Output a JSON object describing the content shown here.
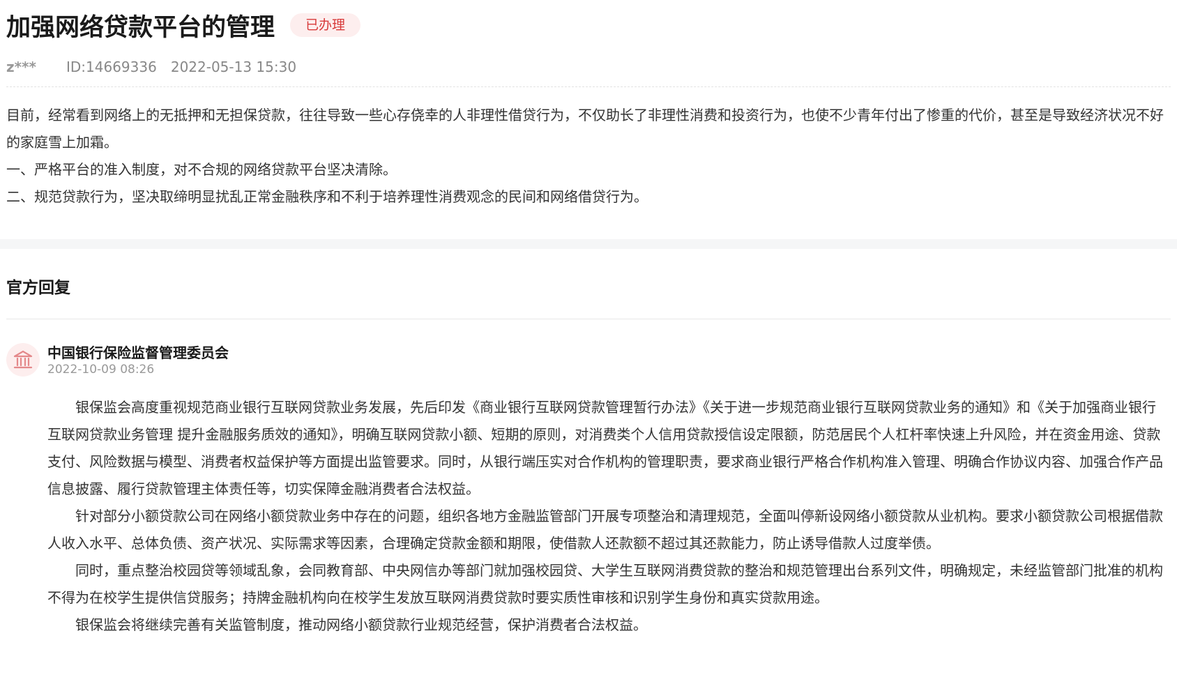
{
  "header": {
    "title": "加强网络贷款平台的管理",
    "status": "已办理",
    "user": "z***",
    "id_label": "ID:14669336",
    "datetime": "2022-05-13 15:30"
  },
  "question": {
    "paragraphs": [
      "目前，经常看到网络上的无抵押和无担保贷款，往往导致一些心存侥幸的人非理性借贷行为，不仅助长了非理性消费和投资行为，也使不少青年付出了惨重的代价，甚至是导致经济状况不好的家庭雪上加霜。",
      "一、严格平台的准入制度，对不合规的网络贷款平台坚决清除。",
      "二、规范贷款行为，坚决取缔明显扰乱正常金融秩序和不利于培养理性消费观念的民间和网络借贷行为。"
    ]
  },
  "reply": {
    "heading": "官方回复",
    "org_icon": "bank-building-icon",
    "org_name": "中国银行保险监督管理委员会",
    "datetime": "2022-10-09 08:26",
    "paragraphs": [
      "银保监会高度重视规范商业银行互联网贷款业务发展，先后印发《商业银行互联网贷款管理暂行办法》《关于进一步规范商业银行互联网贷款业务的通知》和《关于加强商业银行互联网贷款业务管理 提升金融服务质效的通知》，明确互联网贷款小额、短期的原则，对消费类个人信用贷款授信设定限额，防范居民个人杠杆率快速上升风险，并在资金用途、贷款支付、风险数据与模型、消费者权益保护等方面提出监管要求。同时，从银行端压实对合作机构的管理职责，要求商业银行严格合作机构准入管理、明确合作协议内容、加强合作产品信息披露、履行贷款管理主体责任等，切实保障金融消费者合法权益。",
      "针对部分小额贷款公司在网络小额贷款业务中存在的问题，组织各地方金融监管部门开展专项整治和清理规范，全面叫停新设网络小额贷款从业机构。要求小额贷款公司根据借款人收入水平、总体负债、资产状况、实际需求等因素，合理确定贷款金额和期限，使借款人还款额不超过其还款能力，防止诱导借款人过度举债。",
      "同时，重点整治校园贷等领域乱象，会同教育部、中央网信办等部门就加强校园贷、大学生互联网消费贷款的整治和规范管理出台系列文件，明确规定，未经监管部门批准的机构不得为在校学生提供信贷服务；持牌金融机构向在校学生发放互联网消费贷款时要实质性审核和识别学生身份和真实贷款用途。",
      "银保监会将继续完善有关监管制度，推动网络小额贷款行业规范经营，保护消费者合法权益。"
    ]
  },
  "colors": {
    "accent": "#d83a3a",
    "badge_bg": "#fdeeee",
    "band": "#f5f6f7"
  }
}
